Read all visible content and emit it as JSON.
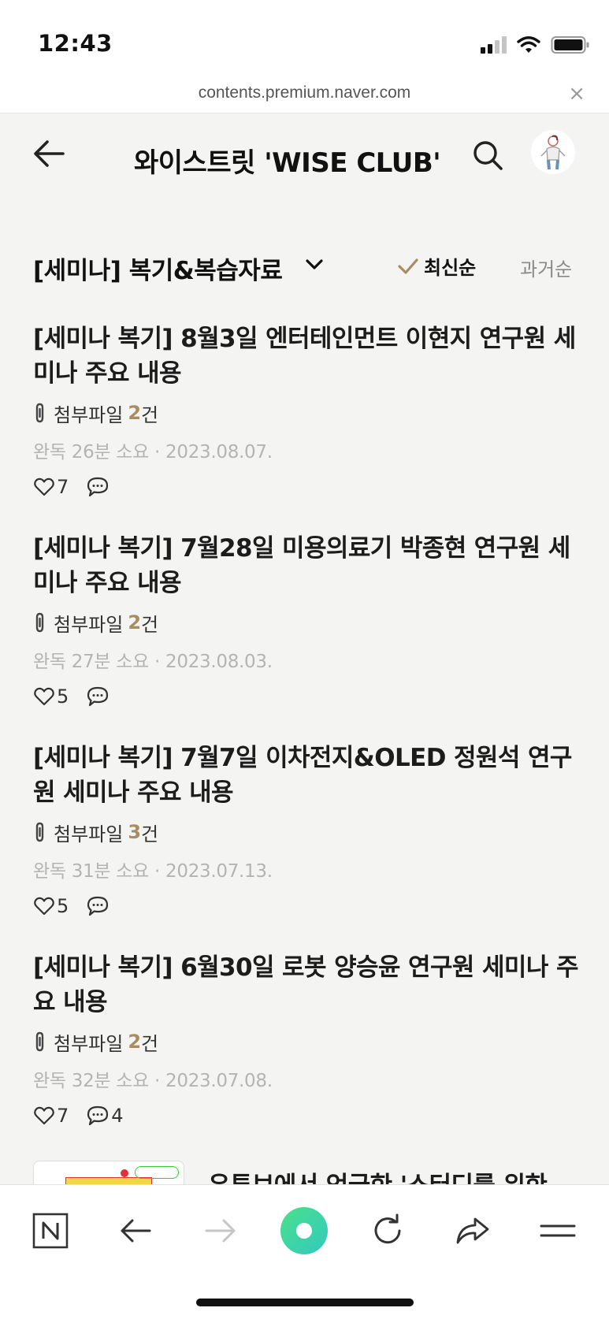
{
  "status_bar": {
    "time": "12:43"
  },
  "browser": {
    "url": "contents.premium.naver.com",
    "close_label": "×"
  },
  "header": {
    "title": "와이스트릿 'WISE CLUB'"
  },
  "category": {
    "title": "[세미나] 복기&복습자료",
    "sort_latest": "최신순",
    "sort_oldest": "과거순",
    "accent_color": "#a88d62"
  },
  "articles": [
    {
      "title": "[세미나 복기] 8월3일 엔터테인먼트 이현지 연구원 세미나 주요 내용",
      "attach_label": "첨부파일",
      "attach_count": "2",
      "attach_unit": "건",
      "meta": "완독 26분 소요 · 2023.08.07.",
      "likes": "7",
      "comments": ""
    },
    {
      "title": "[세미나 복기] 7월28일 미용의료기 박종현 연구원 세미나 주요 내용",
      "attach_label": "첨부파일",
      "attach_count": "2",
      "attach_unit": "건",
      "meta": "완독 27분 소요 · 2023.08.03.",
      "likes": "5",
      "comments": ""
    },
    {
      "title": "[세미나 복기] 7월7일 이차전지&OLED 정원석 연구원 세미나 주요 내용",
      "attach_label": "첨부파일",
      "attach_count": "3",
      "attach_unit": "건",
      "meta": "완독 31분 소요 · 2023.07.13.",
      "likes": "5",
      "comments": ""
    },
    {
      "title": "[세미나 복기] 6월30일 로봇 양승윤 연구원 세미나 주요 내용",
      "attach_label": "첨부파일",
      "attach_count": "2",
      "attach_unit": "건",
      "meta": "완독 32분 소요 · 2023.07.08.",
      "likes": "7",
      "comments": "4"
    }
  ],
  "partial_article": {
    "title": "유튜브에서 언급한 '스터디를 위한"
  },
  "toolbar": {
    "items": [
      "naver-home",
      "back",
      "forward",
      "green-dot",
      "reload",
      "share",
      "menu"
    ],
    "green_color": "#3ddc97"
  }
}
